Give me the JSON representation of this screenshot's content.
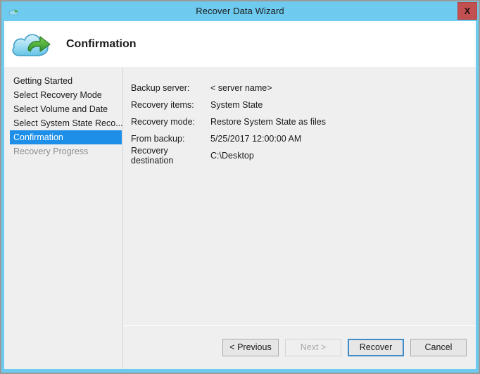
{
  "window": {
    "title": "Recover Data Wizard",
    "titlebar_icon": "cloud-restore-icon",
    "close_label": "X",
    "frame_color": "#6ecbef",
    "close_color": "#c25050"
  },
  "header": {
    "title": "Confirmation",
    "icon": "cloud-restore-icon"
  },
  "sidebar": {
    "items": [
      {
        "label": "Getting Started",
        "state": "normal"
      },
      {
        "label": "Select Recovery Mode",
        "state": "normal"
      },
      {
        "label": "Select Volume and Date",
        "state": "normal"
      },
      {
        "label": "Select System State Reco...",
        "state": "normal"
      },
      {
        "label": "Confirmation",
        "state": "active"
      },
      {
        "label": "Recovery Progress",
        "state": "disabled"
      }
    ],
    "active_color": "#1d8fe8"
  },
  "content": {
    "rows": [
      {
        "label": "Backup server:",
        "value": "< server name>"
      },
      {
        "label": "Recovery items:",
        "value": "System State"
      },
      {
        "label": "Recovery mode:",
        "value": "Restore System State as files"
      },
      {
        "label": "From backup:",
        "value": "5/25/2017 12:00:00 AM"
      },
      {
        "label": "Recovery destination",
        "value": "C:\\Desktop"
      }
    ]
  },
  "footer": {
    "buttons": [
      {
        "label": "< Previous",
        "state": "normal"
      },
      {
        "label": "Next >",
        "state": "disabled"
      },
      {
        "label": "Recover",
        "state": "focused"
      },
      {
        "label": "Cancel",
        "state": "normal"
      }
    ]
  }
}
